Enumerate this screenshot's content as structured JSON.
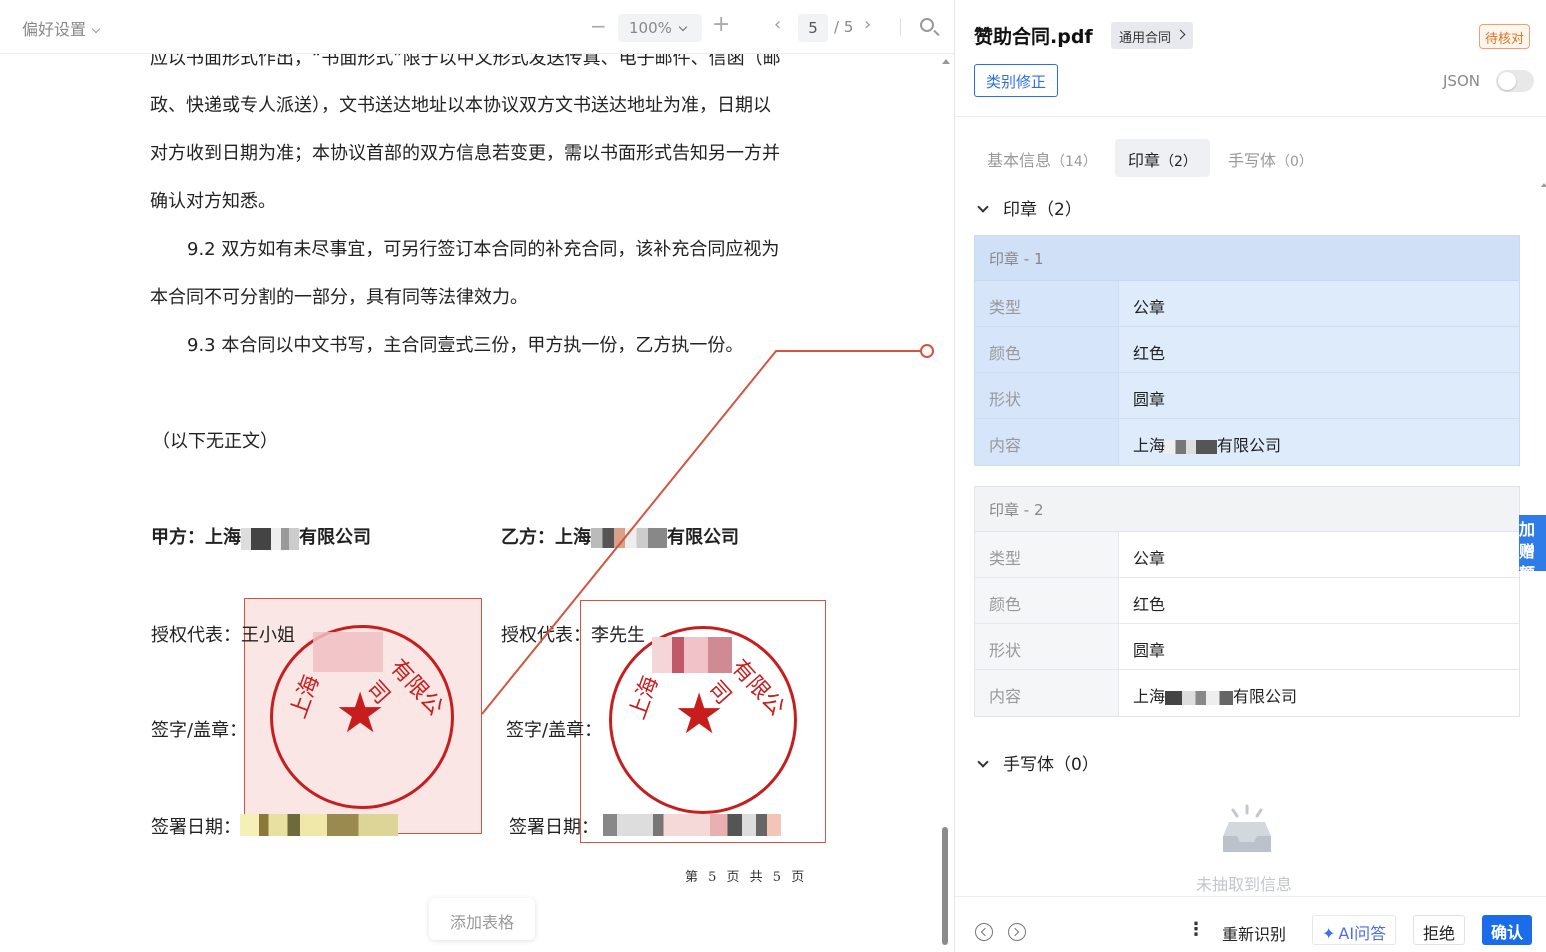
{
  "viewer": {
    "toolbar": {
      "preferences": "偏好设置",
      "zoom_out": "−",
      "zoom": "100%",
      "zoom_in": "+",
      "prev": "‹",
      "current_page": "5",
      "total_pages": "/ 5",
      "next": "›"
    },
    "lines": [
      "应以书面形式作出，“书面形式”限于以中文形式发送传真、电子邮件、信函（邮",
      "政、快递或专人派送），文书送达地址以本协议双方文书送达地址为准，日期以",
      "对方收到日期为准；本协议首部的双方信息若变更，需以书面形式告知另一方并",
      "确认对方知悉。",
      "9.2 双方如有未尽事宜，可另行签订本合同的补充合同，该补充合同应视为",
      "本合同不可分割的一部分，具有同等法律效力。",
      "9.3  本合同以中文书写，主合同壹式三份，甲方执一份，乙方执一份。",
      "（以下无正文）"
    ],
    "party_a": {
      "prefix": "甲方：上海",
      "suffix": "有限公司"
    },
    "party_b": {
      "prefix": "乙方：上海",
      "suffix": "有限公司"
    },
    "rep_a": {
      "label": "授权代表：",
      "value": "王小姐"
    },
    "rep_b": {
      "label": "授权代表：",
      "value": "李先生"
    },
    "sign_a": "签字/盖章：",
    "sign_b": "签字/盖章：",
    "date_a": "签署日期：",
    "date_b": "签署日期：",
    "seal_a": {
      "left": "上海",
      "right": "有限公司"
    },
    "seal_b": {
      "left": "上海",
      "right": "有限公司"
    },
    "footer": "第 5 页 共 5 页",
    "add_table": "添加表格"
  },
  "panel": {
    "title": "赞助合同.pdf",
    "category": "通用合同",
    "status": "待核对",
    "correct_button": "类别修正",
    "json_label": "JSON",
    "json_toggle_on": false,
    "tabs": [
      {
        "label": "基本信息",
        "count": "（14）",
        "active": false
      },
      {
        "label": "印章",
        "count": "（2）",
        "active": true
      },
      {
        "label": "手写体",
        "count": "（0）",
        "active": false
      }
    ],
    "seal_section": "印章（2）",
    "seals": [
      {
        "header": "印章 - 1",
        "rows": [
          {
            "key": "类型",
            "value": "公章"
          },
          {
            "key": "颜色",
            "value": "红色"
          },
          {
            "key": "形状",
            "value": "圆章"
          },
          {
            "key": "内容",
            "value_prefix": "上海",
            "value_suffix": "有限公司"
          }
        ]
      },
      {
        "header": "印章 - 2",
        "rows": [
          {
            "key": "类型",
            "value": "公章"
          },
          {
            "key": "颜色",
            "value": "红色"
          },
          {
            "key": "形状",
            "value": "圆章"
          },
          {
            "key": "内容",
            "value_prefix": "上海",
            "value_suffix": "有限公司"
          }
        ]
      }
    ],
    "handwriting_section": "手写体（0）",
    "empty_text": "未抽取到信息",
    "side_tab": "加赠额度",
    "bottom": {
      "more": "⋮",
      "reidentify": "重新识别",
      "ai": "AI问答",
      "reject": "拒绝",
      "confirm": "确认"
    }
  },
  "colors": {
    "accent_blue": "#1a6ce8",
    "seal_red": "#c81d1d",
    "status_orange": "#e2711d",
    "connector": "#d4553f"
  }
}
